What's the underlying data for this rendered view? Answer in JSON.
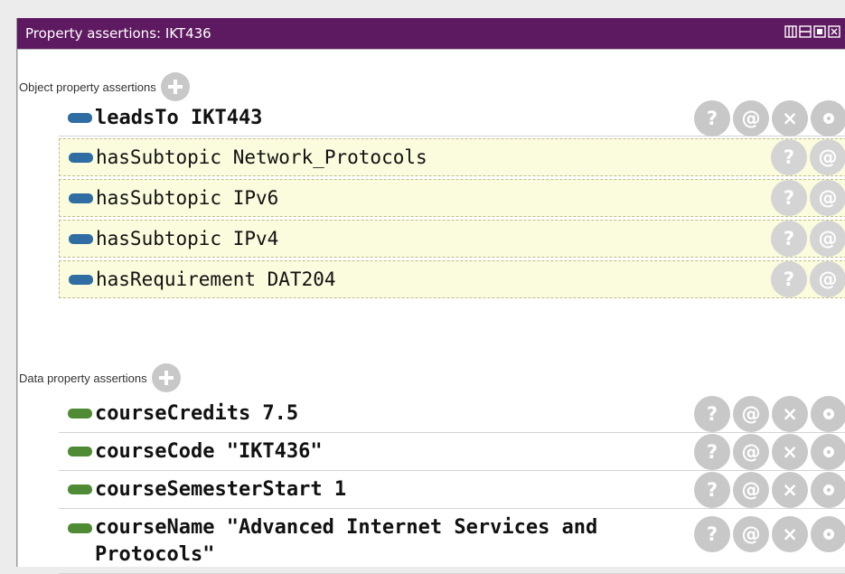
{
  "panel": {
    "title": "Property assertions: IKT436",
    "window_controls": [
      "view-icon",
      "minimize-icon",
      "maximize-icon",
      "close-icon"
    ]
  },
  "object_section": {
    "label": "Object property assertions",
    "add_icon": "plus-circle-icon",
    "rows": [
      {
        "text": "leadsTo  IKT443",
        "asserted": true
      },
      {
        "text": "hasSubtopic  Network_Protocols",
        "asserted": false
      },
      {
        "text": "hasSubtopic  IPv6",
        "asserted": false
      },
      {
        "text": "hasSubtopic  IPv4",
        "asserted": false
      },
      {
        "text": "hasRequirement  DAT204",
        "asserted": false
      }
    ]
  },
  "data_section": {
    "label": "Data property assertions",
    "add_icon": "plus-circle-icon",
    "rows": [
      {
        "text": "courseCredits  7.5"
      },
      {
        "text": "courseCode  \"IKT436\""
      },
      {
        "text": "courseSemesterStart  1"
      },
      {
        "text": "courseName  \"Advanced Internet Services and Protocols\""
      }
    ]
  },
  "row_actions": {
    "explain": "?",
    "annotate": "@",
    "delete": "×",
    "edit": "edit-icon"
  },
  "colors": {
    "titlebar": "#5e1a60",
    "inferred_row_bg": "#fbfbdd",
    "object_property_chip": "#2f6da3",
    "data_property_chip": "#4f8a35",
    "action_button": "#c8c8c8"
  }
}
